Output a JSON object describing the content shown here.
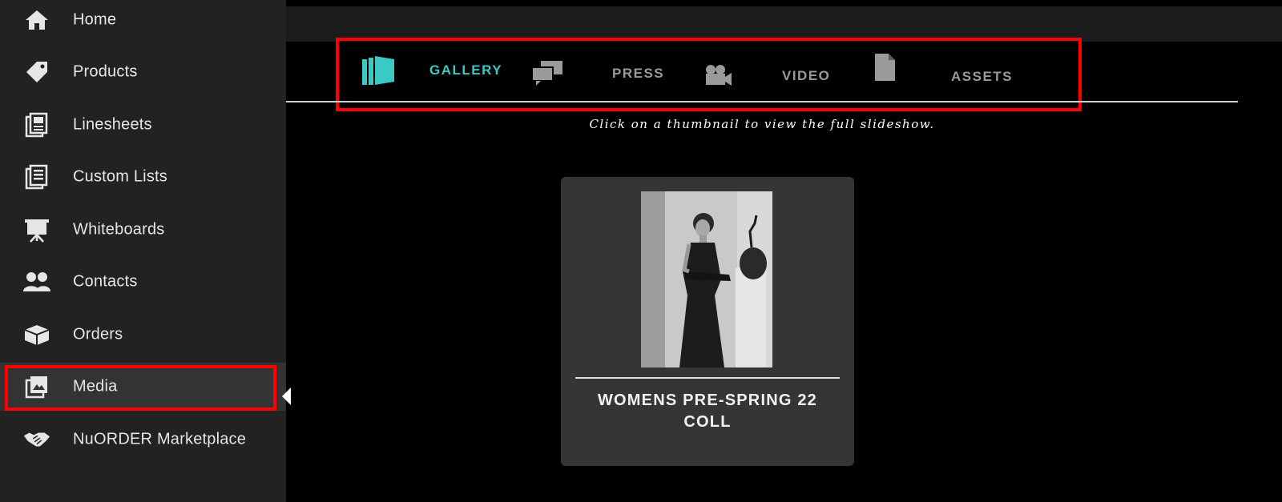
{
  "sidebar": {
    "items": [
      {
        "label": "Home",
        "icon": "home-icon"
      },
      {
        "label": "Products",
        "icon": "tag-icon"
      },
      {
        "label": "Linesheets",
        "icon": "linesheets-icon"
      },
      {
        "label": "Custom Lists",
        "icon": "list-icon"
      },
      {
        "label": "Whiteboards",
        "icon": "whiteboard-icon"
      },
      {
        "label": "Contacts",
        "icon": "contacts-icon"
      },
      {
        "label": "Orders",
        "icon": "box-icon"
      },
      {
        "label": "Media",
        "icon": "media-icon",
        "active": true
      },
      {
        "label": "NuORDER Marketplace",
        "icon": "handshake-icon"
      }
    ]
  },
  "media_tabs": {
    "tabs": [
      {
        "label": "GALLERY",
        "icon": "gallery-icon",
        "active": true
      },
      {
        "label": "PRESS",
        "icon": "press-icon"
      },
      {
        "label": "VIDEO",
        "icon": "video-camera-icon"
      },
      {
        "label": "ASSETS",
        "icon": "document-icon"
      }
    ]
  },
  "gallery": {
    "instruction": "Click on a thumbnail to view the full slideshow.",
    "albums": [
      {
        "title": "WOMENS PRE-SPRING 22 COLL"
      }
    ]
  },
  "colors": {
    "accent": "#3cc8c3",
    "sidebar_bg": "#222222",
    "highlight": "#ff0000"
  }
}
